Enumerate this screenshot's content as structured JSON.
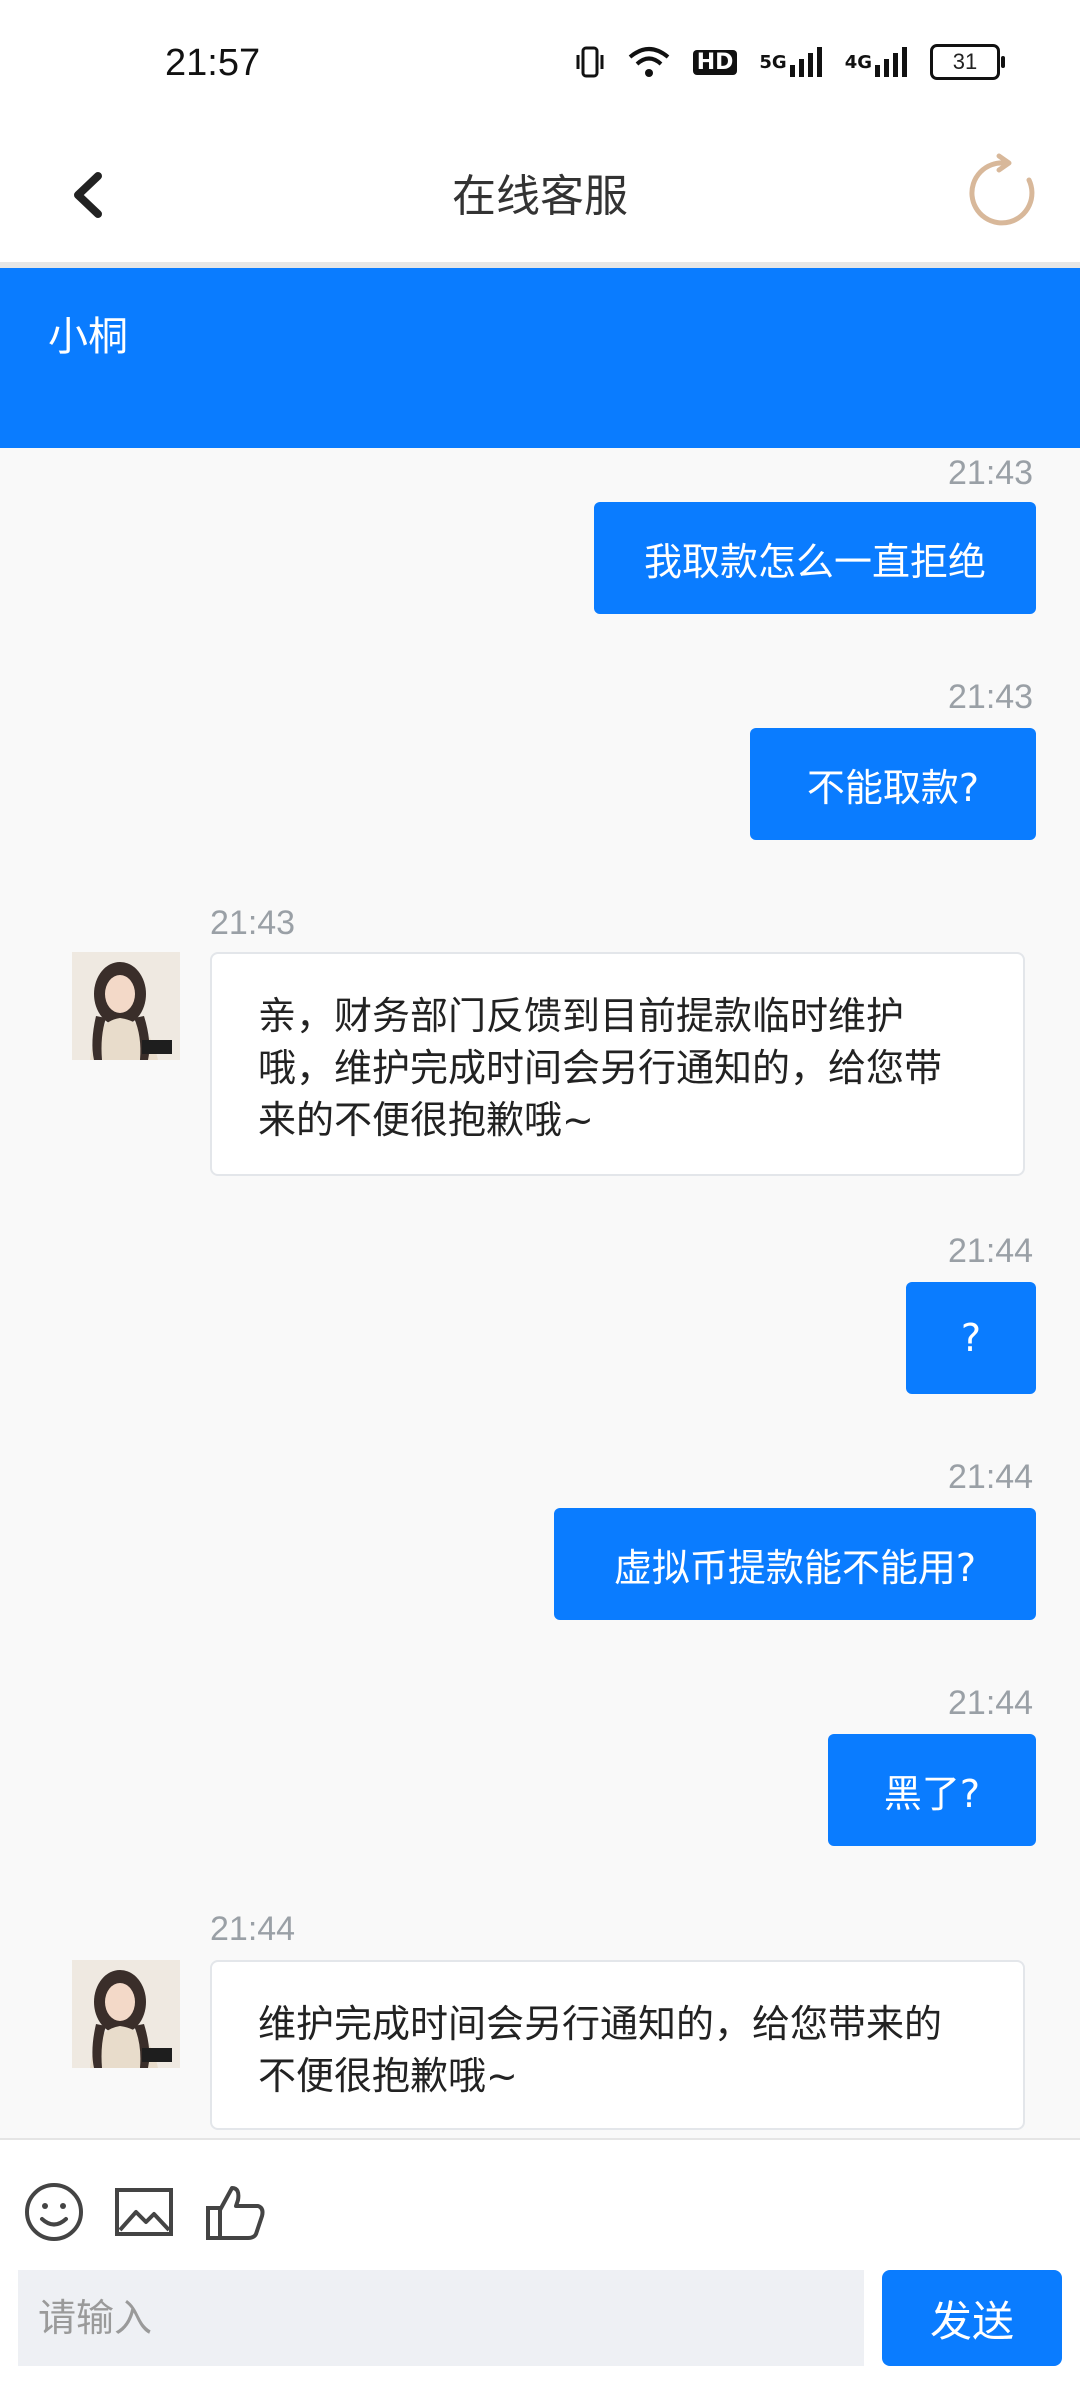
{
  "status_bar": {
    "time": "21:57",
    "icons": [
      "vibrate-icon",
      "wifi-icon",
      "hd-icon",
      "signal-5g-icon",
      "signal-4g-icon"
    ],
    "network_5g": "5G",
    "network_4g": "4G",
    "hd_label": "HD",
    "battery": "31"
  },
  "header": {
    "title": "在线客服",
    "back_icon": "chevron-left-icon",
    "refresh_icon": "refresh-icon"
  },
  "agent": {
    "name": "小桐"
  },
  "messages": [
    {
      "side": "out",
      "time": "21:43",
      "text": "我取款怎么一直拒绝"
    },
    {
      "side": "out",
      "time": "21:43",
      "text": "不能取款?"
    },
    {
      "side": "in",
      "time": "21:43",
      "line1": "亲，财务部门反馈到目前提款临时维护",
      "line2": "哦，维护完成时间会另行通知的，给您带",
      "line3": "来的不便很抱歉哦~"
    },
    {
      "side": "out",
      "time": "21:44",
      "text": "?"
    },
    {
      "side": "out",
      "time": "21:44",
      "text": "虚拟币提款能不能用?"
    },
    {
      "side": "out",
      "time": "21:44",
      "text": "黑了?"
    },
    {
      "side": "in",
      "time": "21:44",
      "line1": "维护完成时间会另行通知的，给您带来的",
      "line2": "不便很抱歉哦~"
    }
  ],
  "composer": {
    "placeholder": "请输入",
    "send_label": "发送",
    "toolbar_icons": [
      "emoji-icon",
      "image-icon",
      "thumbs-up-icon"
    ]
  },
  "colors": {
    "accent": "#0a7cff",
    "refresh": "#d8b89a"
  }
}
